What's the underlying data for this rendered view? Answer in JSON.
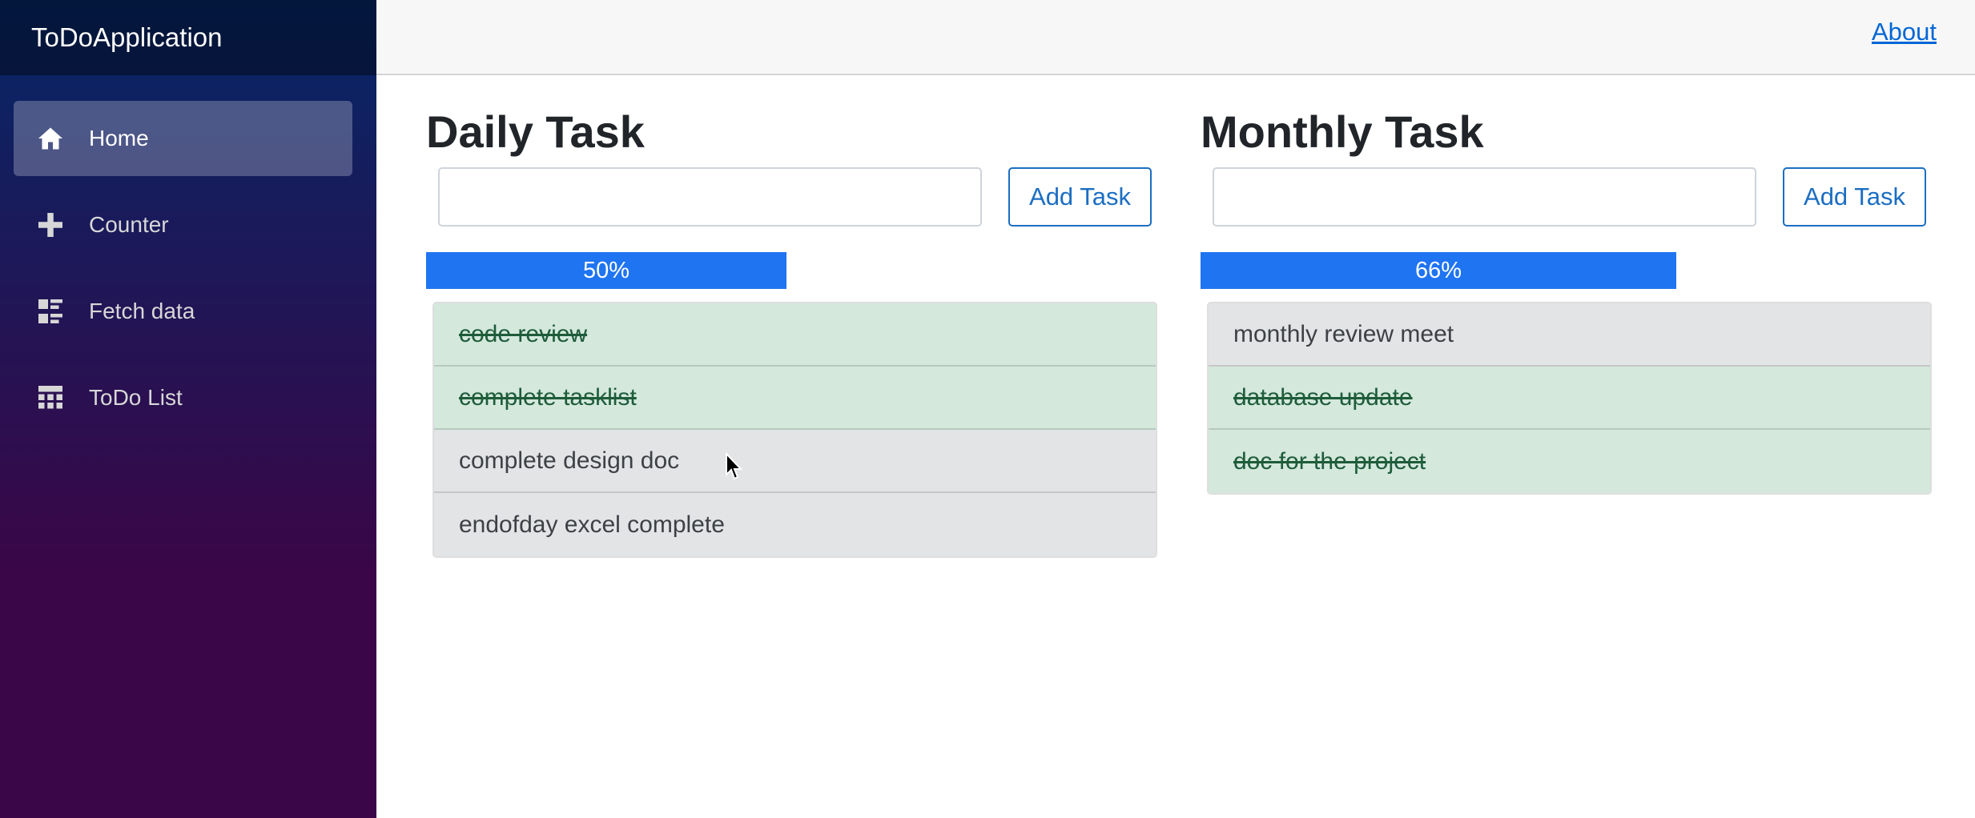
{
  "sidebar": {
    "brand": "ToDoApplication",
    "items": [
      {
        "label": "Home",
        "icon": "home-icon",
        "active": true
      },
      {
        "label": "Counter",
        "icon": "plus-icon",
        "active": false
      },
      {
        "label": "Fetch data",
        "icon": "list-rich-icon",
        "active": false
      },
      {
        "label": "ToDo List",
        "icon": "spreadsheet-icon",
        "active": false
      }
    ]
  },
  "header": {
    "about_label": "About"
  },
  "daily": {
    "title": "Daily Task",
    "input_value": "",
    "add_label": "Add Task",
    "progress_label": "50%",
    "progress": 0.5,
    "tasks": [
      {
        "text": "code review",
        "done": true
      },
      {
        "text": "complete tasklist",
        "done": true
      },
      {
        "text": "complete design doc",
        "done": false
      },
      {
        "text": "endofday excel complete",
        "done": false
      }
    ]
  },
  "monthly": {
    "title": "Monthly Task",
    "input_value": "",
    "add_label": "Add Task",
    "progress_label": "66%",
    "progress": 0.66,
    "tasks": [
      {
        "text": "monthly review meet",
        "done": false
      },
      {
        "text": "database update",
        "done": true
      },
      {
        "text": "doc for the project",
        "done": true
      }
    ]
  },
  "colors": {
    "accent": "#1b6ec2",
    "progress": "#1f74f2",
    "done_bg": "#d4e8dc",
    "pending_bg": "#e3e4e6"
  }
}
